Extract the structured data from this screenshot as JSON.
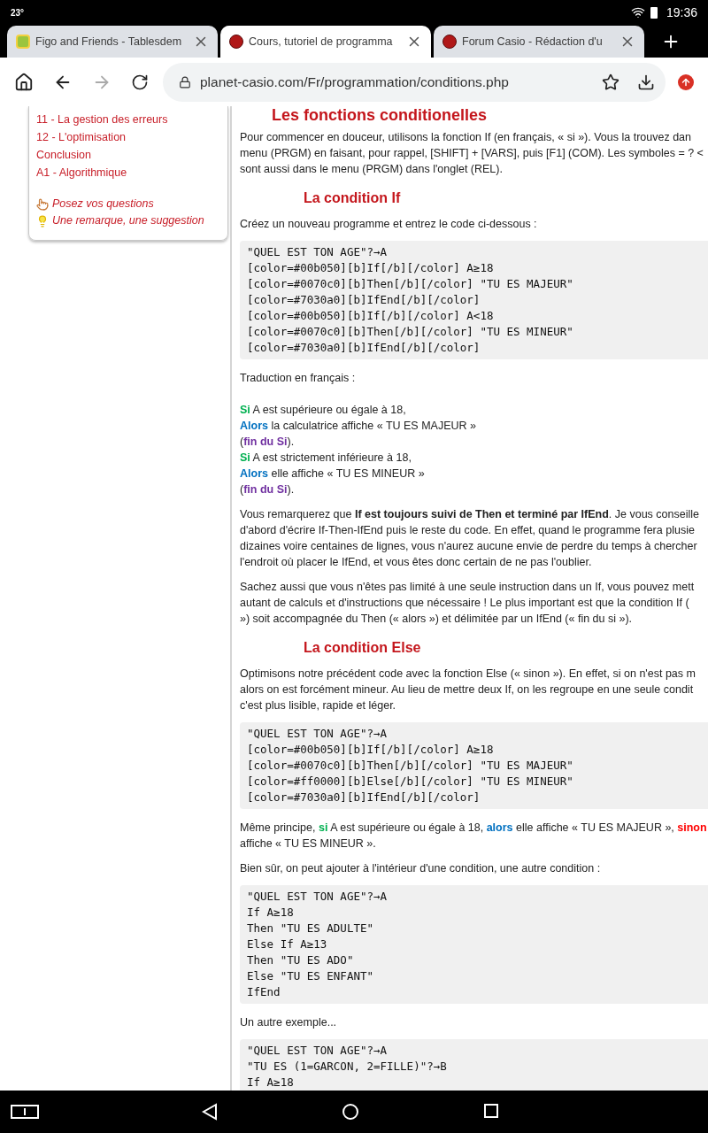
{
  "status_bar": {
    "temperature": "23°",
    "time": "19:36"
  },
  "tabs": [
    {
      "title": "Figo and Friends - Tablesdem",
      "kind": "tile",
      "selected": false
    },
    {
      "title": "Cours, tutoriel de programma",
      "kind": "round",
      "selected": true
    },
    {
      "title": "Forum Casio - Rédaction d'u",
      "kind": "round",
      "selected": false
    }
  ],
  "toolbar": {
    "url": "planet-casio.com/Fr/programmation/conditions.php"
  },
  "sidebar": {
    "items": [
      "11 - La gestion des erreurs",
      "12 - L'optimisation",
      "Conclusion",
      "A1 - Algorithmique"
    ],
    "links": [
      {
        "text": "Posez vos questions",
        "kind": "hand"
      },
      {
        "text": "Une remarque, une suggestion",
        "kind": "bulb"
      }
    ]
  },
  "article": {
    "blocks": [
      {
        "kind": "title",
        "text": "Les fonctions conditionelles"
      },
      {
        "kind": "paragraph",
        "lines": [
          [
            {
              "text": "Pour commencer en douceur, utilisons la fonction If (en français, « si »). Vous la trouvez dan"
            }
          ],
          [
            {
              "text": "menu (PRGM) en faisant, pour rappel, [SHIFT] + [VARS], puis [F1] (COM). Les symboles = ? <"
            }
          ],
          [
            {
              "text": "sont aussi dans le menu (PRGM) dans l'onglet (REL)."
            }
          ]
        ]
      },
      {
        "kind": "heading",
        "text": "La condition If"
      },
      {
        "kind": "paragraph",
        "lines": [
          [
            {
              "text": "Créez un nouveau programme et entrez le code ci-dessous :"
            }
          ]
        ]
      },
      {
        "kind": "code",
        "lines": [
          "\"QUEL EST TON AGE\"?→A",
          "[color=#00b050][b]If[/b][/color] A≥18",
          "[color=#0070c0][b]Then[/b][/color] \"TU ES MAJEUR\"",
          "[color=#7030a0][b]IfEnd[/b][/color]",
          "[color=#00b050][b]If[/b][/color] A<18",
          "[color=#0070c0][b]Then[/b][/color] \"TU ES MINEUR\"",
          "[color=#7030a0][b]IfEnd[/b][/color]"
        ]
      },
      {
        "kind": "paragraph",
        "lines": [
          [
            {
              "text": "Traduction en français :"
            }
          ]
        ]
      },
      {
        "kind": "translation",
        "lines": [
          [
            {
              "text": "Si",
              "color": "#00b050"
            },
            {
              "text": " A est supérieure ou égale à 18,"
            }
          ],
          [
            {
              "text": "Alors",
              "color": "#0070c0"
            },
            {
              "text": " la calculatrice affiche « TU ES MAJEUR »"
            }
          ],
          [
            {
              "text": "("
            },
            {
              "text": "fin du Si",
              "color": "#7030a0"
            },
            {
              "text": ")."
            }
          ],
          [
            {
              "text": "Si",
              "color": "#00b050"
            },
            {
              "text": " A est strictement inférieure à 18,"
            }
          ],
          [
            {
              "text": "Alors",
              "color": "#0070c0"
            },
            {
              "text": " elle affiche « TU ES MINEUR »"
            }
          ],
          [
            {
              "text": "("
            },
            {
              "text": "fin du Si",
              "color": "#7030a0"
            },
            {
              "text": ")."
            }
          ]
        ]
      },
      {
        "kind": "paragraph",
        "lines": [
          [
            {
              "text": "Vous remarquerez que **If est toujours suivi de Then et terminé par IfEnd**. Je vous conseille"
            }
          ],
          [
            {
              "text": "d'abord d'écrire If-Then-IfEnd puis le reste du code. En effet, quand le programme fera plusie"
            }
          ],
          [
            {
              "text": "dizaines voire centaines de lignes, vous n'aurez aucune envie de perdre du temps à chercher"
            }
          ],
          [
            {
              "text": "l'endroit où placer le IfEnd, et vous êtes donc certain de ne pas l'oublier."
            }
          ]
        ]
      },
      {
        "kind": "paragraph",
        "lines": [
          [
            {
              "text": "Sachez aussi que vous n'êtes pas limité à une seule instruction dans un If, vous pouvez mett"
            }
          ],
          [
            {
              "text": "autant de calculs et d'instructions que nécessaire ! Le plus important est que la condition If ("
            }
          ],
          [
            {
              "text": "») soit accompagnée du Then (« alors ») et délimitée par un IfEnd (« fin du si »)."
            }
          ]
        ]
      },
      {
        "kind": "heading",
        "text": "La condition Else"
      },
      {
        "kind": "paragraph",
        "lines": [
          [
            {
              "text": "Optimisons notre précédent code avec la fonction Else (« sinon »). En effet, si on n'est pas m"
            }
          ],
          [
            {
              "text": "alors on est forcément mineur. Au lieu de mettre deux If, on les regroupe en une seule condit"
            }
          ],
          [
            {
              "text": "c'est plus lisible, rapide et léger."
            }
          ]
        ]
      },
      {
        "kind": "code",
        "lines": [
          "\"QUEL EST TON AGE\"?→A",
          "[color=#00b050][b]If[/b][/color] A≥18",
          "[color=#0070c0][b]Then[/b][/color] \"TU ES MAJEUR\"",
          "[color=#ff0000][b]Else[/b][/color] \"TU ES MINEUR\"",
          "[color=#7030a0][b]IfEnd[/b][/color]"
        ]
      },
      {
        "kind": "paragraph",
        "lines": [
          [
            {
              "text": "Même principe, "
            },
            {
              "text": "si",
              "color": "#00b050"
            },
            {
              "text": " A est supérieure ou égale à 18, "
            },
            {
              "text": "alors",
              "color": "#0070c0"
            },
            {
              "text": " elle affiche « TU ES MAJEUR », "
            },
            {
              "text": "sinon",
              "color": "#ff0000"
            }
          ],
          [
            {
              "text": "affiche « TU ES MINEUR »."
            }
          ]
        ]
      },
      {
        "kind": "paragraph",
        "lines": [
          [
            {
              "text": "Bien sûr, on peut ajouter à l'intérieur d'une condition, une autre condition :"
            }
          ]
        ]
      },
      {
        "kind": "code",
        "lines": [
          "\"QUEL EST TON AGE\"?→A",
          "If A≥18",
          "Then \"TU ES ADULTE\"",
          "Else If A≥13",
          "Then \"TU ES ADO\"",
          "Else \"TU ES ENFANT\"",
          "IfEnd"
        ]
      },
      {
        "kind": "paragraph",
        "lines": [
          [
            {
              "text": "Un autre exemple..."
            }
          ]
        ]
      },
      {
        "kind": "code",
        "lines": [
          "\"QUEL EST TON AGE\"?→A",
          "\"TU ES (1=GARCON, 2=FILLE)\"?→B",
          "If A≥18"
        ]
      }
    ]
  }
}
